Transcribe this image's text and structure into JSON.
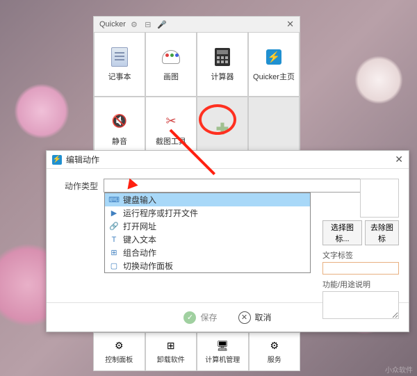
{
  "quicker": {
    "title": "Quicker",
    "grid": [
      {
        "label": "记事本",
        "icon": "notepad"
      },
      {
        "label": "画图",
        "icon": "paint"
      },
      {
        "label": "计算器",
        "icon": "calc"
      },
      {
        "label": "Quicker主页",
        "icon": "bolt"
      },
      {
        "label": "静音",
        "icon": "mute"
      },
      {
        "label": "截图工具",
        "icon": "scissors"
      },
      {
        "label": "",
        "icon": "plus"
      },
      {
        "label": "",
        "icon": ""
      }
    ]
  },
  "dialog": {
    "title": "编辑动作",
    "type_label": "动作类型",
    "dropdown": [
      {
        "label": "键盘输入",
        "icon": "keyboard"
      },
      {
        "label": "运行程序或打开文件",
        "icon": "run"
      },
      {
        "label": "打开网址",
        "icon": "link"
      },
      {
        "label": "键入文本",
        "icon": "text"
      },
      {
        "label": "组合动作",
        "icon": "group"
      },
      {
        "label": "切换动作面板",
        "icon": "panel"
      }
    ],
    "select_icon_btn": "选择图标...",
    "remove_icon_btn": "去除图标",
    "text_label": "文字标签",
    "desc_label": "功能/用途说明",
    "save": "保存",
    "cancel": "取消"
  },
  "bottom": [
    {
      "label": "控制面板",
      "icon": "⚙"
    },
    {
      "label": "卸载软件",
      "icon": "⊞"
    },
    {
      "label": "计算机管理",
      "icon": "🖥"
    },
    {
      "label": "服务",
      "icon": "⚙"
    }
  ],
  "watermark": "小众软件"
}
